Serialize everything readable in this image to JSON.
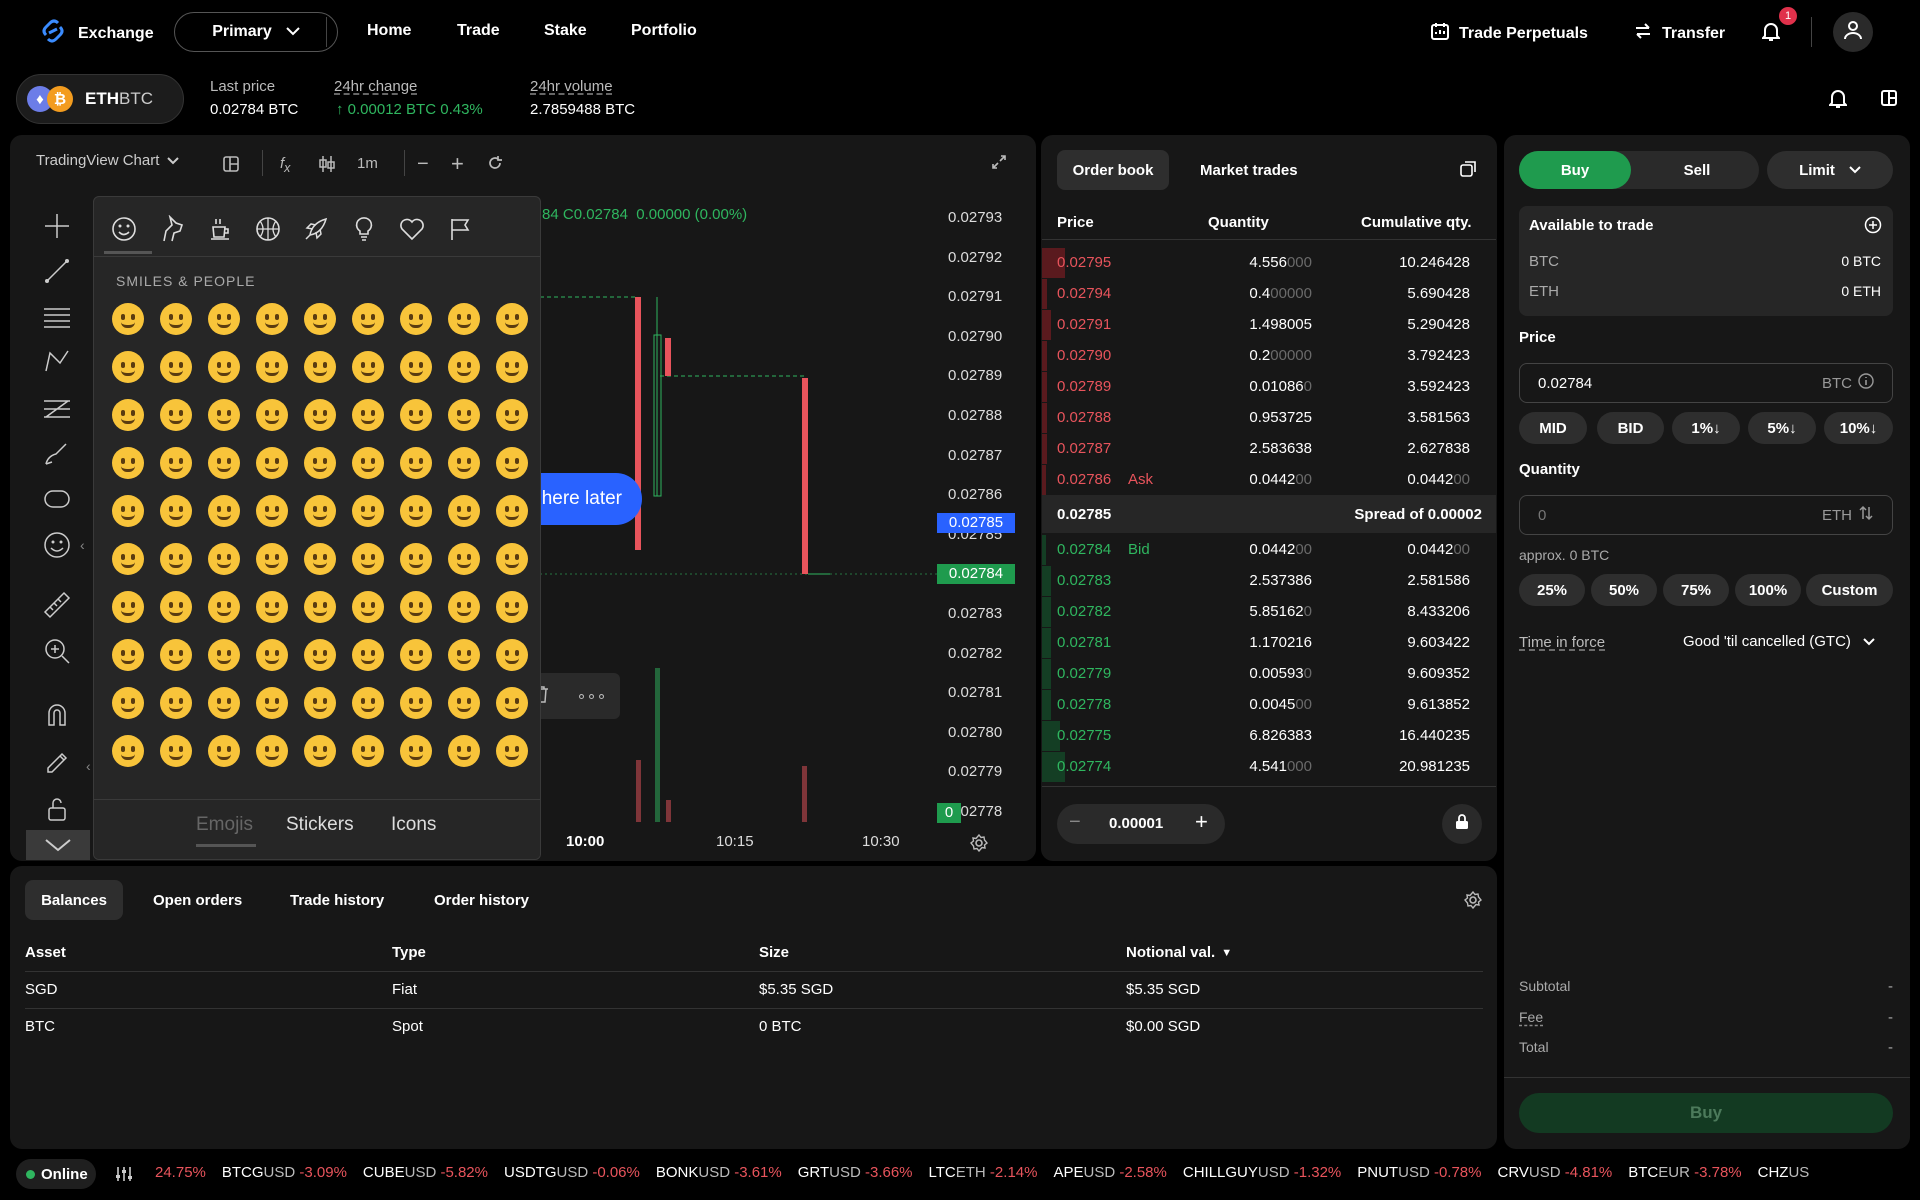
{
  "nav": {
    "brand": "Exchange",
    "account": "Primary",
    "links": [
      "Home",
      "Trade",
      "Stake",
      "Portfolio"
    ],
    "trade_perpetuals": "Trade Perpetuals",
    "transfer": "Transfer",
    "notification_count": "1"
  },
  "market": {
    "base": "ETH",
    "quote": "BTC",
    "last_price_label": "Last price",
    "last_price": "0.02784 BTC",
    "change_label": "24hr change",
    "change": "↑ 0.00012 BTC 0.43%",
    "volume_label": "24hr volume",
    "volume": "2.7859488 BTC"
  },
  "chart": {
    "title": "TradingView Chart",
    "interval": "1m",
    "ohlc_fragment": "84 C",
    "ohlc_close": "0.02784",
    "ohlc_change": "0.00000 (0.00%)",
    "y_ticks": [
      "0.02793",
      "0.02792",
      "0.02791",
      "0.02790",
      "0.02789",
      "0.02788",
      "0.02787",
      "0.02786",
      "0.02785",
      "0.02784",
      "0.02783",
      "0.02782",
      "0.02781",
      "0.02780",
      "0.02779",
      "0.02778"
    ],
    "highlight_blue": "0.02785",
    "highlight_green": "0.02784",
    "highlight_vol": "0",
    "x_ticks": [
      "10:00",
      "10:15",
      "10:30"
    ],
    "tooltip_fragment": "here later",
    "colors": {
      "up": "#2fb65f",
      "down": "#e8545c",
      "accent": "#2962ff"
    }
  },
  "emoji_picker": {
    "section_title": "SMILES & PEOPLE",
    "tabs": [
      "Emojis",
      "Stickers",
      "Icons"
    ],
    "categories": [
      "smiley-icon",
      "unicorn-icon",
      "coffee-icon",
      "basketball-icon",
      "rocket-icon",
      "lightbulb-icon",
      "heart-icon",
      "flag-icon"
    ]
  },
  "orderbook": {
    "tab_book": "Order book",
    "tab_trades": "Market trades",
    "col_price": "Price",
    "col_qty": "Quantity",
    "col_cum": "Cumulative qty.",
    "asks": [
      {
        "price": "0.02795",
        "qty": "4.556",
        "qty_dim": "000",
        "cum": "10.246428",
        "cum_dim": "",
        "depth": 0.05
      },
      {
        "price": "0.02794",
        "qty": "0.4",
        "qty_dim": "00000",
        "cum": "5.690428",
        "cum_dim": "",
        "depth": 0.01
      },
      {
        "price": "0.02791",
        "qty": "1.498005",
        "qty_dim": "",
        "cum": "5.290428",
        "cum_dim": "",
        "depth": 0.02
      },
      {
        "price": "0.02790",
        "qty": "0.2",
        "qty_dim": "00000",
        "cum": "3.792423",
        "cum_dim": "",
        "depth": 0.01
      },
      {
        "price": "0.02789",
        "qty": "0.01086",
        "qty_dim": "0",
        "cum": "3.592423",
        "cum_dim": "",
        "depth": 0.01
      },
      {
        "price": "0.02788",
        "qty": "0.953725",
        "qty_dim": "",
        "cum": "3.581563",
        "cum_dim": "",
        "depth": 0.01
      },
      {
        "price": "0.02787",
        "qty": "2.583638",
        "qty_dim": "",
        "cum": "2.627838",
        "cum_dim": "",
        "depth": 0.01
      },
      {
        "price": "0.02786",
        "tag": "Ask",
        "qty": "0.0442",
        "qty_dim": "00",
        "cum": "0.0442",
        "cum_dim": "00",
        "depth": 0.0
      }
    ],
    "spread_price": "0.02785",
    "spread_text": "Spread of 0.00002",
    "bids": [
      {
        "price": "0.02784",
        "tag": "Bid",
        "qty": "0.0442",
        "qty_dim": "00",
        "cum": "0.0442",
        "cum_dim": "00",
        "depth": 0.0
      },
      {
        "price": "0.02783",
        "qty": "2.537386",
        "qty_dim": "",
        "cum": "2.581586",
        "cum_dim": "",
        "depth": 0.02
      },
      {
        "price": "0.02782",
        "qty": "5.85162",
        "qty_dim": "0",
        "cum": "8.433206",
        "cum_dim": "",
        "depth": 0.02
      },
      {
        "price": "0.02781",
        "qty": "1.170216",
        "qty_dim": "",
        "cum": "9.603422",
        "cum_dim": "",
        "depth": 0.02
      },
      {
        "price": "0.02779",
        "qty": "0.00593",
        "qty_dim": "0",
        "cum": "9.609352",
        "cum_dim": "",
        "depth": 0.02
      },
      {
        "price": "0.02778",
        "qty": "0.0045",
        "qty_dim": "00",
        "cum": "9.613852",
        "cum_dim": "",
        "depth": 0.02
      },
      {
        "price": "0.02775",
        "qty": "6.826383",
        "qty_dim": "",
        "cum": "16.440235",
        "cum_dim": "",
        "depth": 0.04
      },
      {
        "price": "0.02774",
        "qty": "4.541",
        "qty_dim": "000",
        "cum": "20.981235",
        "cum_dim": "",
        "depth": 0.05
      }
    ],
    "tick_size": "0.00001"
  },
  "order_form": {
    "buy": "Buy",
    "sell": "Sell",
    "order_type": "Limit",
    "available_title": "Available to trade",
    "avail": [
      {
        "asset": "BTC",
        "value": "0 BTC"
      },
      {
        "asset": "ETH",
        "value": "0 ETH"
      }
    ],
    "price_label": "Price",
    "price_value": "0.02784",
    "price_unit": "BTC",
    "price_chips": [
      "MID",
      "BID",
      "1%↓",
      "5%↓",
      "10%↓"
    ],
    "qty_label": "Quantity",
    "qty_placeholder": "0",
    "qty_unit": "ETH",
    "approx": "approx. 0 BTC",
    "pct_chips": [
      "25%",
      "50%",
      "75%",
      "100%",
      "Custom"
    ],
    "tif_label": "Time in force",
    "tif_value": "Good 'til cancelled (GTC)",
    "subtotal_label": "Subtotal",
    "subtotal": "-",
    "fee_label": "Fee",
    "fee": "-",
    "total_label": "Total",
    "total": "-",
    "submit": "Buy"
  },
  "bottom": {
    "tabs": [
      "Balances",
      "Open orders",
      "Trade history",
      "Order history"
    ],
    "columns": [
      "Asset",
      "Type",
      "Size",
      "Notional val."
    ],
    "rows": [
      [
        "SGD",
        "Fiat",
        "$5.35 SGD",
        "$5.35 SGD"
      ],
      [
        "BTC",
        "Spot",
        "0 BTC",
        "$0.00 SGD"
      ]
    ]
  },
  "status": {
    "online": "Online",
    "ticker": [
      {
        "sym": "",
        "quote": "",
        "chg": "24.75%"
      },
      {
        "sym": "BTCG",
        "quote": "USD",
        "chg": "-3.09%"
      },
      {
        "sym": "CUBE",
        "quote": "USD",
        "chg": "-5.82%"
      },
      {
        "sym": "USDTG",
        "quote": "USD",
        "chg": "-0.06%"
      },
      {
        "sym": "BONK",
        "quote": "USD",
        "chg": "-3.61%"
      },
      {
        "sym": "GRT",
        "quote": "USD",
        "chg": "-3.66%"
      },
      {
        "sym": "LTC",
        "quote": "ETH",
        "chg": "-2.14%"
      },
      {
        "sym": "APE",
        "quote": "USD",
        "chg": "-2.58%"
      },
      {
        "sym": "CHILLGUY",
        "quote": "USD",
        "chg": "-1.32%"
      },
      {
        "sym": "PNUT",
        "quote": "USD",
        "chg": "-0.78%"
      },
      {
        "sym": "CRV",
        "quote": "USD",
        "chg": "-4.81%"
      },
      {
        "sym": "BTC",
        "quote": "EUR",
        "chg": "-3.78%"
      },
      {
        "sym": "CHZ",
        "quote": "US",
        "chg": ""
      }
    ]
  }
}
